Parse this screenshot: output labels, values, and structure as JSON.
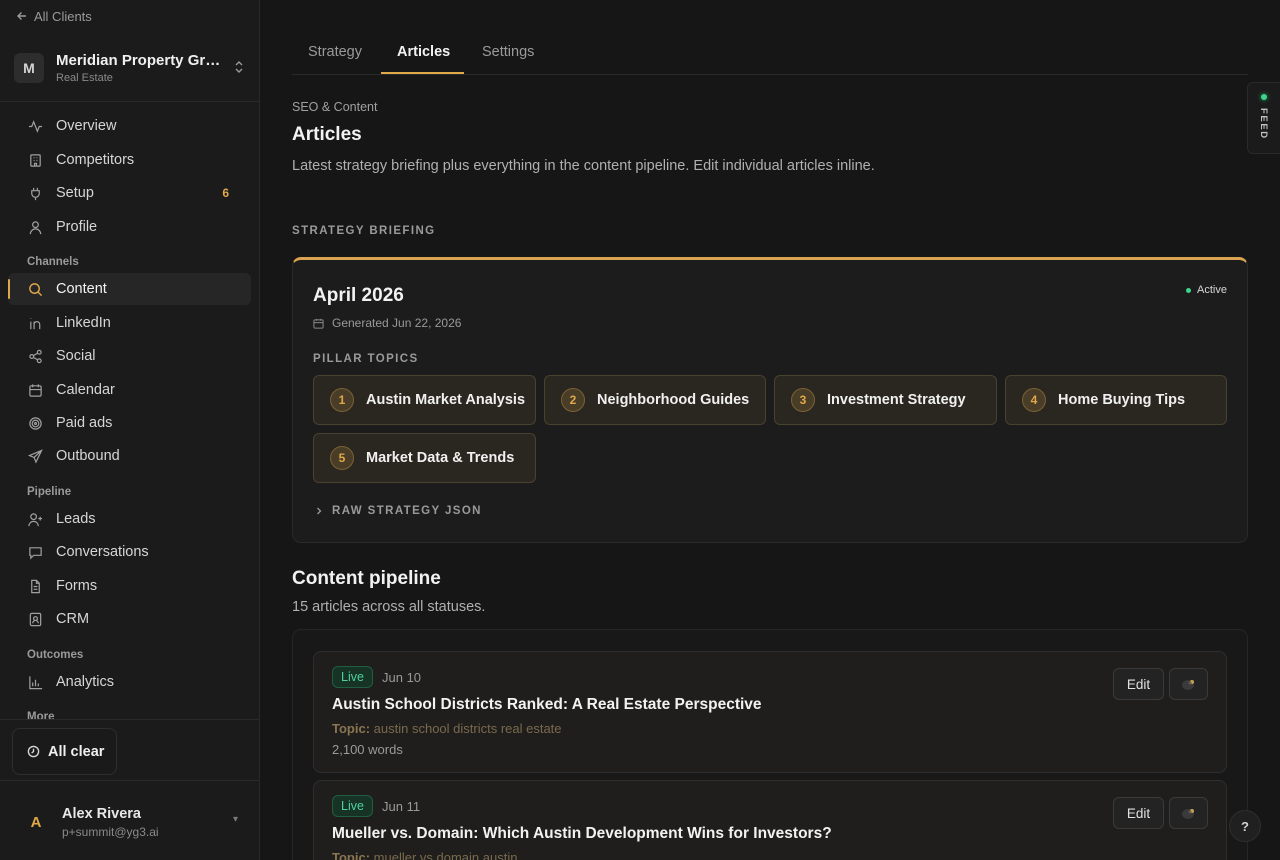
{
  "sidebar": {
    "back_label": "All Clients",
    "client": {
      "initial": "M",
      "name": "Meridian Property Group",
      "industry": "Real Estate"
    },
    "nav": {
      "overview": "Overview",
      "competitors": "Competitors",
      "setup": "Setup",
      "setup_badge": "6",
      "profile": "Profile",
      "channels_heading": "Channels",
      "content": "Content",
      "linkedin": "LinkedIn",
      "social": "Social",
      "calendar": "Calendar",
      "paid_ads": "Paid ads",
      "outbound": "Outbound",
      "pipeline_heading": "Pipeline",
      "leads": "Leads",
      "conversations": "Conversations",
      "forms": "Forms",
      "crm": "CRM",
      "outcomes_heading": "Outcomes",
      "analytics": "Analytics",
      "more_heading": "More"
    },
    "status_button": "All clear",
    "user": {
      "initial": "A",
      "name": "Alex Rivera",
      "email": "p+summit@yg3.ai"
    }
  },
  "tabs": {
    "strategy": "Strategy",
    "articles": "Articles",
    "settings": "Settings"
  },
  "header": {
    "eyebrow": "SEO & Content",
    "title": "Articles",
    "description": "Latest strategy briefing plus everything in the content pipeline. Edit individual articles inline."
  },
  "briefing": {
    "section_label": "STRATEGY BRIEFING",
    "title": "April 2026",
    "generated": "Generated Jun 22, 2026",
    "status": "Active",
    "pillar_label": "PILLAR TOPICS",
    "pillars": [
      {
        "num": "1",
        "label": "Austin Market Analysis"
      },
      {
        "num": "2",
        "label": "Neighborhood Guides"
      },
      {
        "num": "3",
        "label": "Investment Strategy"
      },
      {
        "num": "4",
        "label": "Home Buying Tips"
      },
      {
        "num": "5",
        "label": "Market Data & Trends"
      }
    ],
    "raw_json_label": "RAW STRATEGY JSON"
  },
  "pipeline": {
    "title": "Content pipeline",
    "subtitle": "15 articles across all statuses.",
    "topic_prefix": "Topic:",
    "edit_label": "Edit",
    "articles": [
      {
        "status": "Live",
        "date": "Jun 10",
        "title": "Austin School Districts Ranked: A Real Estate Perspective",
        "topic": "austin school districts real estate",
        "words": "2,100 words"
      },
      {
        "status": "Live",
        "date": "Jun 11",
        "title": "Mueller vs. Domain: Which Austin Development Wins for Investors?",
        "topic": "mueller vs domain austin",
        "words": ""
      }
    ]
  },
  "feed_label": "FEED",
  "help_label": "?",
  "colors": {
    "accent": "#e0a84a",
    "live": "#4fd29a",
    "active_dot": "#3bd68c"
  }
}
